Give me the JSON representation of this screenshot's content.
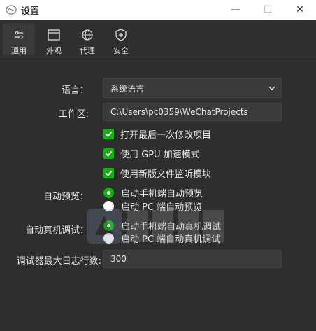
{
  "window": {
    "title": "设置",
    "minimize_glyph": "—",
    "maximize_glyph": "☐",
    "close_glyph": "✕"
  },
  "tabs": [
    {
      "label": "通用",
      "icon": "sliders-icon",
      "active": true
    },
    {
      "label": "外观",
      "icon": "window-icon",
      "active": false
    },
    {
      "label": "代理",
      "icon": "globe-icon",
      "active": false
    },
    {
      "label": "安全",
      "icon": "shield-icon",
      "active": false
    }
  ],
  "settings": {
    "language": {
      "label": "语言：",
      "value": "系统语言"
    },
    "workdir": {
      "label": "工作区:",
      "value": "C:\\Users\\pc0359\\WeChatProjects"
    },
    "checkboxes": [
      {
        "label": "打开最后一次修改项目",
        "checked": true
      },
      {
        "label": "使用 GPU 加速模式",
        "checked": true
      },
      {
        "label": "使用新版文件监听模块",
        "checked": true
      }
    ],
    "auto_preview": {
      "label": "自动预览：",
      "options": [
        {
          "label": "启动手机端自动预览",
          "selected": true
        },
        {
          "label": "启动 PC 端自动预览",
          "selected": false
        }
      ]
    },
    "auto_realdebug": {
      "label": "自动真机调试：",
      "options": [
        {
          "label": "启动手机端自动真机调试",
          "selected": true
        },
        {
          "label": "启动 PC 端自动真机调试",
          "selected": false
        }
      ]
    },
    "max_log_lines": {
      "label": "调试器最大日志行数:",
      "value": "300"
    }
  },
  "colors": {
    "accent": "#1aad19",
    "background": "#2e2e2e",
    "field": "#3a3a3a"
  }
}
